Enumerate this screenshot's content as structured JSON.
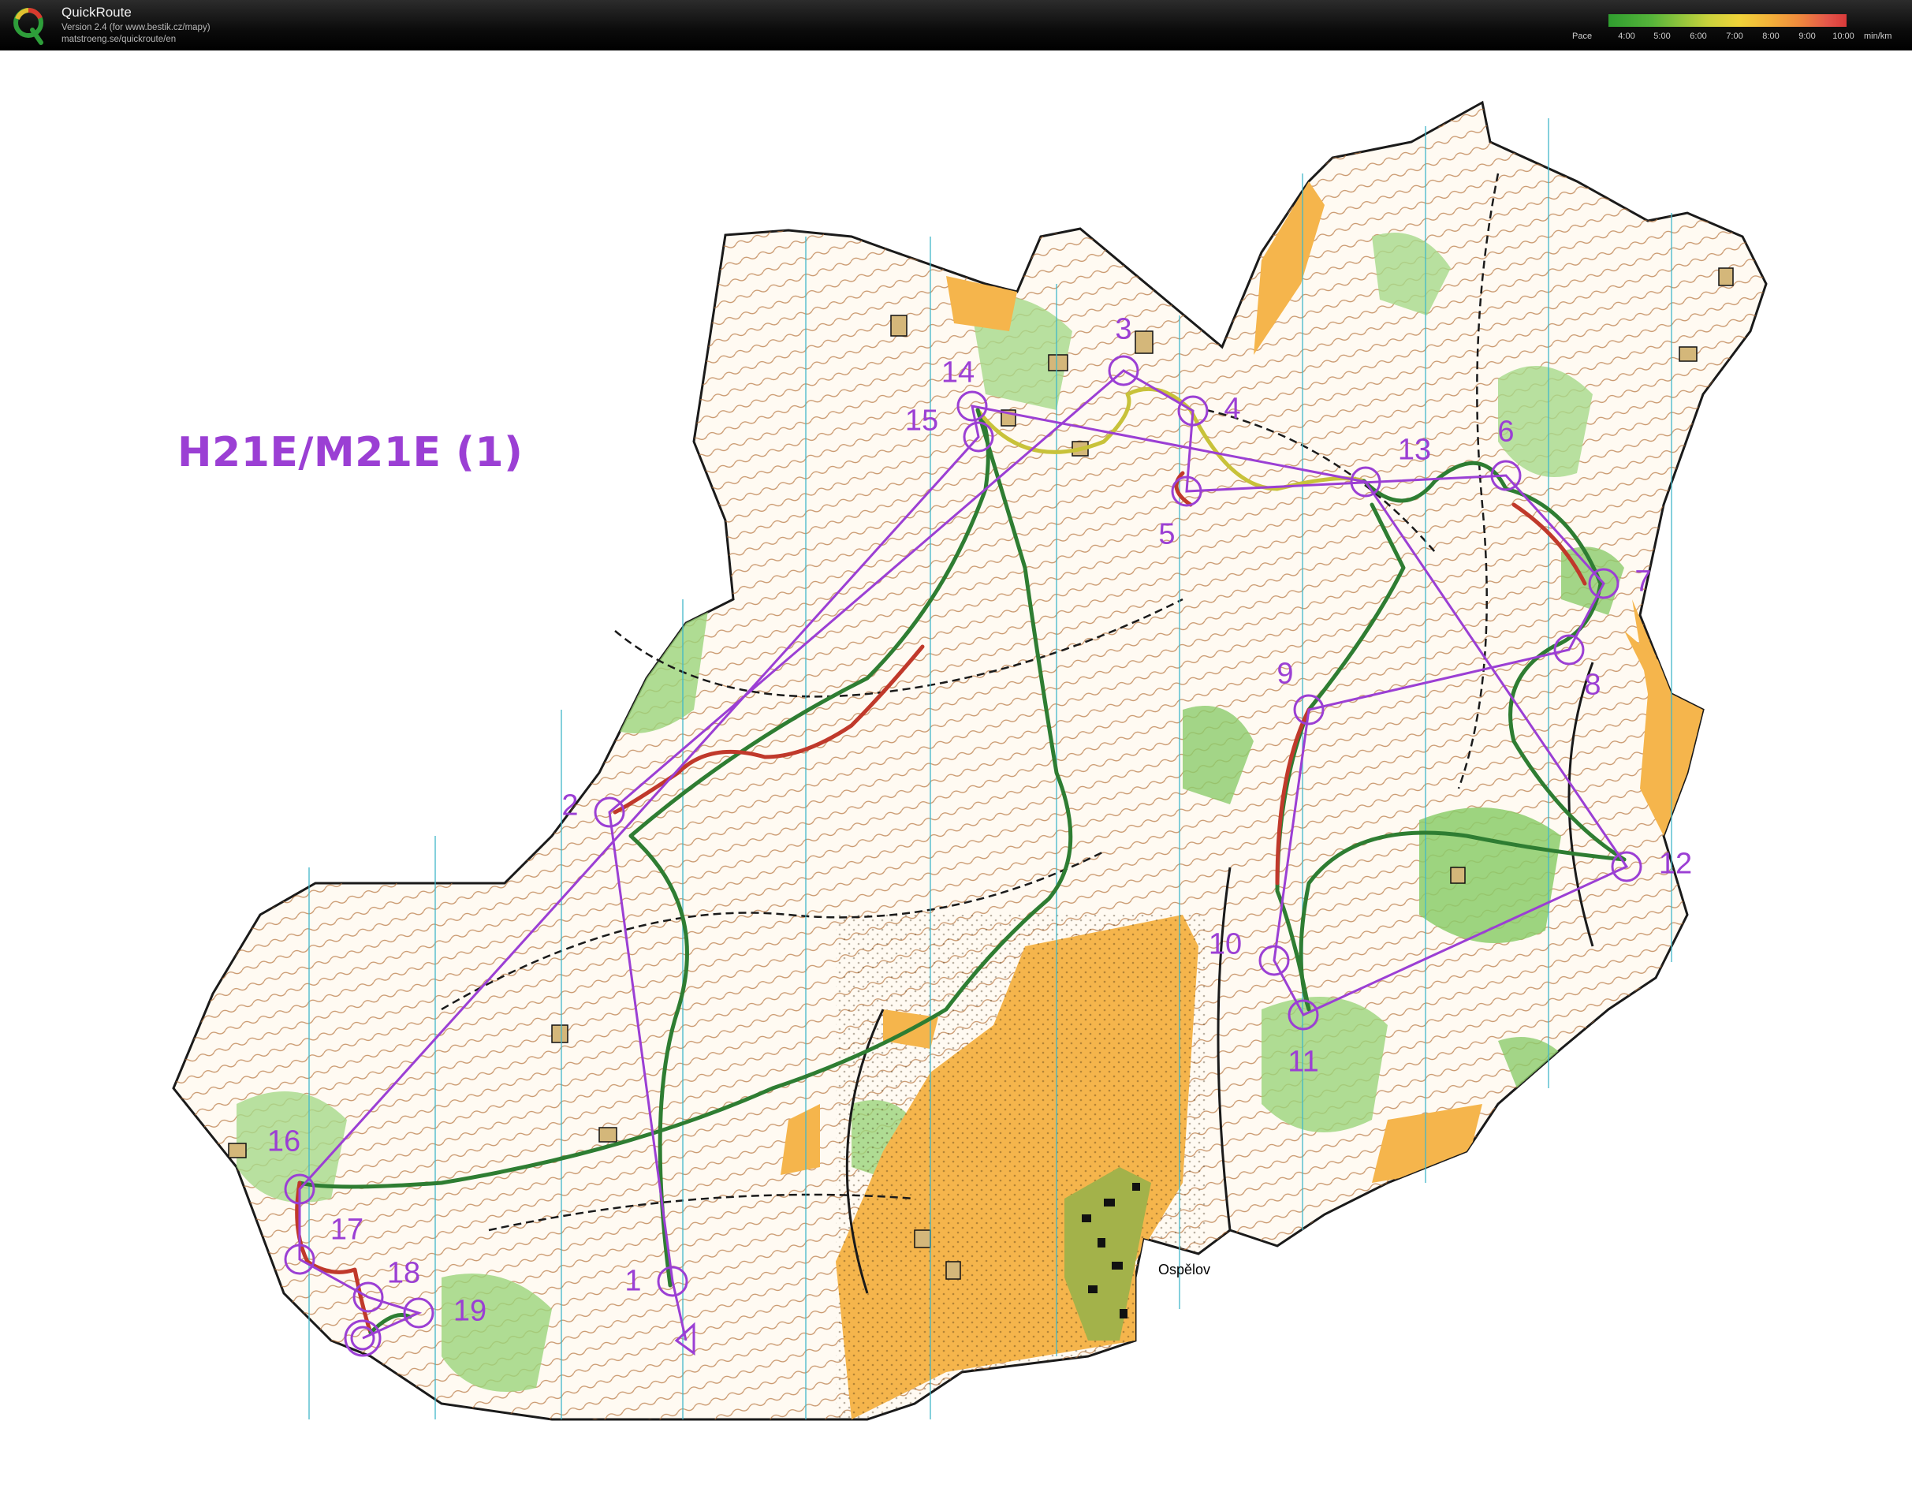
{
  "header": {
    "app_name": "QuickRoute",
    "version_line": "Version 2.4  (for www.bestik.cz/mapy)",
    "url_line": "matstroeng.se/quickroute/en",
    "pace_label": "Pace",
    "pace_ticks": [
      "4:00",
      "5:00",
      "6:00",
      "7:00",
      "8:00",
      "9:00",
      "10:00"
    ],
    "pace_unit": "min/km",
    "logo_icon": "quickroute-q-logo-icon"
  },
  "map": {
    "course_title": "H21E/M21E (1)",
    "village_label": "Ospělov",
    "colors": {
      "course": "#9b3fd4",
      "route_fast": "#2e7d32",
      "route_mid": "#c8c23a",
      "route_slow": "#c0392b",
      "forest_green": "#8ccc6b",
      "open_land": "#f5b54c",
      "contour": "#b07040"
    },
    "controls": [
      {
        "label": "1"
      },
      {
        "label": "2"
      },
      {
        "label": "3"
      },
      {
        "label": "4"
      },
      {
        "label": "5"
      },
      {
        "label": "6"
      },
      {
        "label": "7"
      },
      {
        "label": "8"
      },
      {
        "label": "9"
      },
      {
        "label": "10"
      },
      {
        "label": "11"
      },
      {
        "label": "12"
      },
      {
        "label": "13"
      },
      {
        "label": "14"
      },
      {
        "label": "15"
      },
      {
        "label": "16"
      },
      {
        "label": "17"
      },
      {
        "label": "18"
      },
      {
        "label": "19"
      }
    ]
  }
}
